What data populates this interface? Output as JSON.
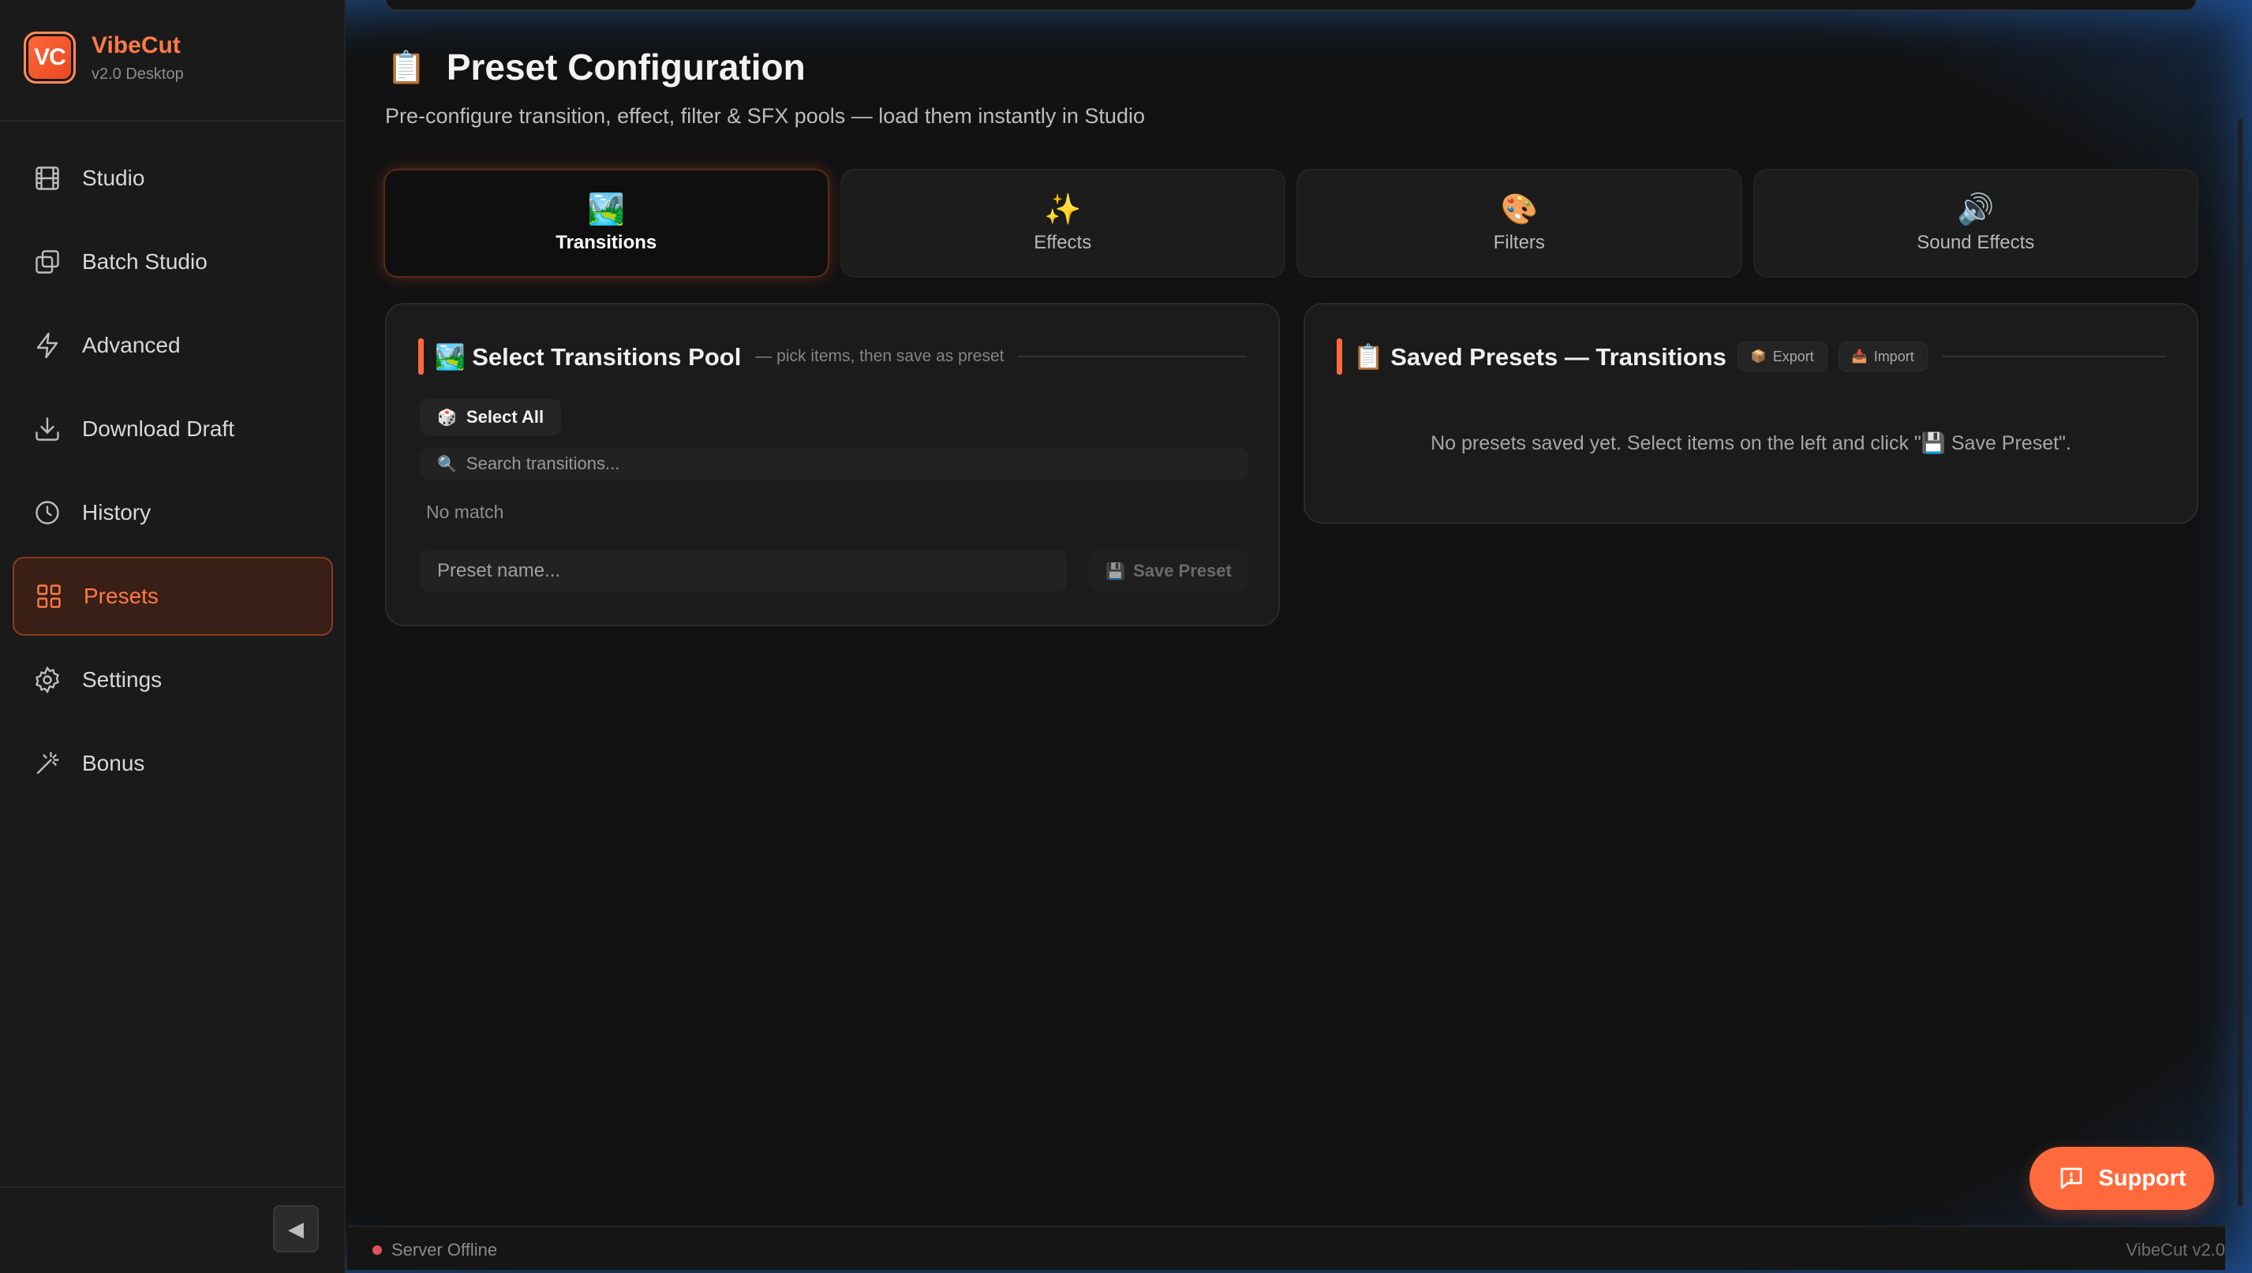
{
  "brand": {
    "logo": "VC",
    "name": "VibeCut",
    "version": "v2.0 Desktop"
  },
  "sidebar": {
    "items": [
      {
        "label": "Studio",
        "icon": "film-icon"
      },
      {
        "label": "Batch Studio",
        "icon": "copy-icon"
      },
      {
        "label": "Advanced",
        "icon": "lightning-icon"
      },
      {
        "label": "Download Draft",
        "icon": "download-icon"
      },
      {
        "label": "History",
        "icon": "clock-icon"
      },
      {
        "label": "Presets",
        "icon": "grid-icon",
        "active": true
      },
      {
        "label": "Settings",
        "icon": "gear-icon"
      },
      {
        "label": "Bonus",
        "icon": "magic-wand-icon"
      }
    ],
    "collapse_glyph": "◀"
  },
  "page": {
    "emoji": "📋",
    "title": "Preset Configuration",
    "subtitle": "Pre-configure transition, effect, filter & SFX pools — load them instantly in Studio"
  },
  "tabs": [
    {
      "emoji": "🏞️",
      "label": "Transitions",
      "active": true
    },
    {
      "emoji": "✨",
      "label": "Effects"
    },
    {
      "emoji": "🎨",
      "label": "Filters"
    },
    {
      "emoji": "🔊",
      "label": "Sound Effects"
    }
  ],
  "pool": {
    "emoji": "🏞️",
    "title": "Select Transitions Pool",
    "hint": "— pick items, then save as preset",
    "select_all_emoji": "🎲",
    "select_all": "Select All",
    "search_emoji": "🔍",
    "search_placeholder": "Search transitions...",
    "no_match": "No match",
    "preset_name_placeholder": "Preset name...",
    "save_emoji": "💾",
    "save_label": "Save Preset"
  },
  "saved": {
    "emoji": "📋",
    "title": "Saved Presets — Transitions",
    "export_emoji": "📦",
    "export_label": "Export",
    "import_emoji": "📥",
    "import_label": "Import",
    "empty_message": "No presets saved yet. Select items on the left and click \"💾 Save Preset\"."
  },
  "support_label": "Support",
  "status": {
    "server": "Server Offline",
    "version": "VibeCut v2.0"
  },
  "colors": {
    "accent": "#ff6a3d",
    "offline": "#e0545c"
  }
}
